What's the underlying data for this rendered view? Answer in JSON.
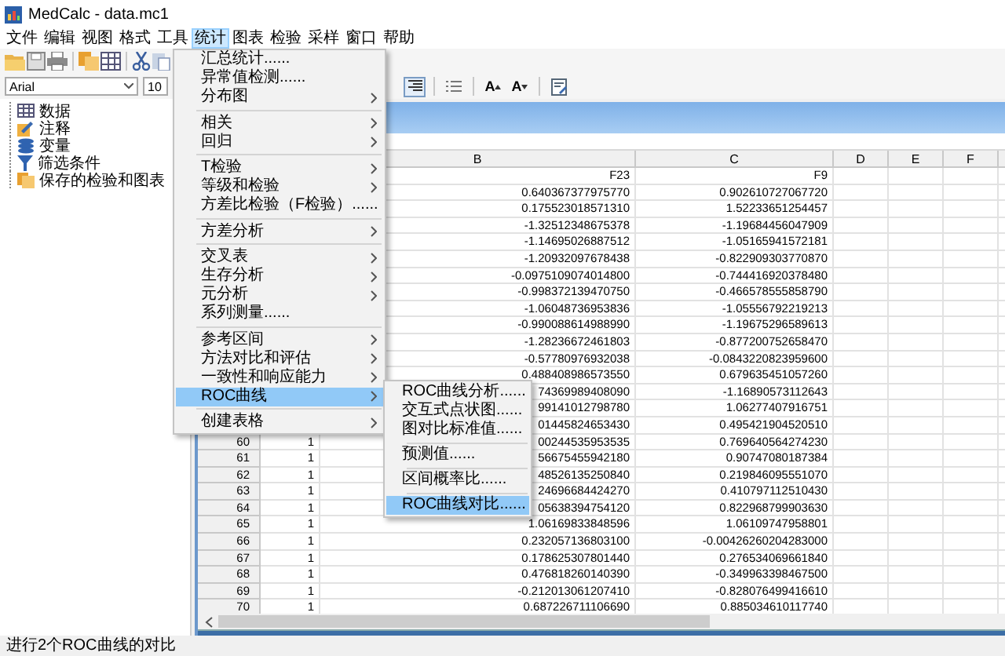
{
  "window": {
    "title": "MedCalc - data.mc1"
  },
  "menubar": [
    {
      "label": "文件",
      "selected": false
    },
    {
      "label": "编辑",
      "selected": false
    },
    {
      "label": "视图",
      "selected": false
    },
    {
      "label": "格式",
      "selected": false
    },
    {
      "label": "工具",
      "selected": false
    },
    {
      "label": "统计",
      "selected": true
    },
    {
      "label": "图表",
      "selected": false
    },
    {
      "label": "检验",
      "selected": false
    },
    {
      "label": "采样",
      "selected": false
    },
    {
      "label": "窗口",
      "selected": false
    },
    {
      "label": "帮助",
      "selected": false
    }
  ],
  "format_bar": {
    "font": {
      "value": "Arial"
    },
    "size": {
      "value": "10"
    },
    "buttons": [
      {
        "kind": "align",
        "on": true
      },
      {
        "kind": "list",
        "on": false
      },
      {
        "kind": "grow",
        "label": "A",
        "on": false
      },
      {
        "kind": "shrink",
        "label": "A",
        "on": false
      },
      {
        "kind": "edit",
        "on": false
      }
    ]
  },
  "tree": [
    {
      "label": "数据",
      "kind": "table"
    },
    {
      "label": "注释",
      "kind": "notes"
    },
    {
      "label": "变量",
      "kind": "variables"
    },
    {
      "label": "筛选条件",
      "kind": "filter"
    },
    {
      "label": "保存的检验和图表",
      "kind": "saved"
    }
  ],
  "sheet": {
    "columns": [
      "B",
      "C",
      "D",
      "E",
      "F"
    ],
    "names": {
      "b": "F23",
      "c": "F9"
    },
    "rows": [
      {
        "b": "0.640367377975770",
        "c": "0.902610727067720"
      },
      {
        "b": "0.175523018571310",
        "c": "1.52233651254457"
      },
      {
        "b": "-1.32512348675378",
        "c": "-1.19684456047909"
      },
      {
        "b": "-1.14695026887512",
        "c": "-1.05165941572181"
      },
      {
        "b": "-1.20932097678438",
        "c": "-0.822909303770870"
      },
      {
        "b": "-0.0975109074014800",
        "c": "-0.744416920378480"
      },
      {
        "b": "-0.998372139470750",
        "c": "-0.466578555858790"
      },
      {
        "b": "-1.06048736953836",
        "c": "-1.05556792219213"
      },
      {
        "b": "-0.990088614988990",
        "c": "-1.19675296589613"
      },
      {
        "b": "-1.28236672461803",
        "c": "-0.877200752658470"
      },
      {
        "b": "-0.57780976932038",
        "c": "-0.0843220823959600"
      },
      {
        "b": "0.488408986573550",
        "c": "0.679635451057260"
      },
      {
        "b": "74369989408090",
        "c": "-1.16890573112643"
      },
      {
        "b": "99141012798780",
        "c": "1.06277407916751"
      },
      {
        "b": "01445824653430",
        "c": "0.495421904520510"
      },
      {
        "row_number": "60",
        "a": "1",
        "b": "00244535953535",
        "c": "0.769640564274230"
      },
      {
        "row_number": "61",
        "a": "1",
        "b": "56675455942180",
        "c": "0.90747080187384"
      },
      {
        "row_number": "62",
        "a": "1",
        "b": "48526135250840",
        "c": "0.219846095551070"
      },
      {
        "row_number": "63",
        "a": "1",
        "b": "24696684424270",
        "c": "0.410797112510430"
      },
      {
        "row_number": "64",
        "a": "1",
        "b": "05638394754120",
        "c": "0.822968799903630"
      },
      {
        "row_number": "65",
        "a": "1",
        "b": "1.06169833848596",
        "c": "1.06109747958801"
      },
      {
        "row_number": "66",
        "a": "1",
        "b": "0.232057136803100",
        "c": "-0.00426260204283000"
      },
      {
        "row_number": "67",
        "a": "1",
        "b": "0.178625307801440",
        "c": "0.276534069661840"
      },
      {
        "row_number": "68",
        "a": "1",
        "b": "0.476818260140390",
        "c": "-0.349963398467500"
      },
      {
        "row_number": "69",
        "a": "1",
        "b": "-0.212013061207410",
        "c": "-0.828076499416610"
      },
      {
        "row_number": "70",
        "a": "1",
        "b": "0.687226711106690",
        "c": "0.885034610117740"
      }
    ]
  },
  "stats_menu": [
    {
      "kind": "item",
      "label": "汇总统计......",
      "has_submenu": false,
      "selected": false
    },
    {
      "kind": "item",
      "label": "异常值检测......",
      "has_submenu": false,
      "selected": false
    },
    {
      "kind": "item",
      "label": "分布图",
      "has_submenu": true,
      "selected": false
    },
    {
      "kind": "separator"
    },
    {
      "kind": "item",
      "label": "相关",
      "has_submenu": true,
      "selected": false
    },
    {
      "kind": "item",
      "label": "回归",
      "has_submenu": true,
      "selected": false
    },
    {
      "kind": "separator"
    },
    {
      "kind": "item",
      "label": "T检验",
      "has_submenu": true,
      "selected": false
    },
    {
      "kind": "item",
      "label": "等级和检验",
      "has_submenu": true,
      "selected": false
    },
    {
      "kind": "item",
      "label": "方差比检验（F检验）......",
      "has_submenu": false,
      "selected": false
    },
    {
      "kind": "separator"
    },
    {
      "kind": "item",
      "label": "方差分析",
      "has_submenu": true,
      "selected": false
    },
    {
      "kind": "separator"
    },
    {
      "kind": "item",
      "label": "交叉表",
      "has_submenu": true,
      "selected": false
    },
    {
      "kind": "item",
      "label": "生存分析",
      "has_submenu": true,
      "selected": false
    },
    {
      "kind": "item",
      "label": "元分析",
      "has_submenu": true,
      "selected": false
    },
    {
      "kind": "item",
      "label": "系列测量......",
      "has_submenu": false,
      "selected": false
    },
    {
      "kind": "separator"
    },
    {
      "kind": "item",
      "label": "参考区间",
      "has_submenu": true,
      "selected": false
    },
    {
      "kind": "item",
      "label": "方法对比和评估",
      "has_submenu": true,
      "selected": false
    },
    {
      "kind": "item",
      "label": "一致性和响应能力",
      "has_submenu": true,
      "selected": false
    },
    {
      "kind": "item",
      "label": "ROC曲线",
      "has_submenu": true,
      "selected": true
    },
    {
      "kind": "separator"
    },
    {
      "kind": "item",
      "label": "创建表格",
      "has_submenu": true,
      "selected": false
    }
  ],
  "roc_submenu": [
    {
      "kind": "item",
      "label": "ROC曲线分析......",
      "selected": false
    },
    {
      "kind": "item",
      "label": "交互式点状图......",
      "selected": false
    },
    {
      "kind": "item",
      "label": "图对比标准值......",
      "selected": false
    },
    {
      "kind": "separator"
    },
    {
      "kind": "item",
      "label": "预测值......",
      "selected": false
    },
    {
      "kind": "separator"
    },
    {
      "kind": "item",
      "label": "区间概率比......",
      "selected": false
    },
    {
      "kind": "separator"
    },
    {
      "kind": "item",
      "label": "ROC曲线对比......",
      "selected": true
    }
  ],
  "status_bar": {
    "text": "进行2个ROC曲线的对比"
  }
}
